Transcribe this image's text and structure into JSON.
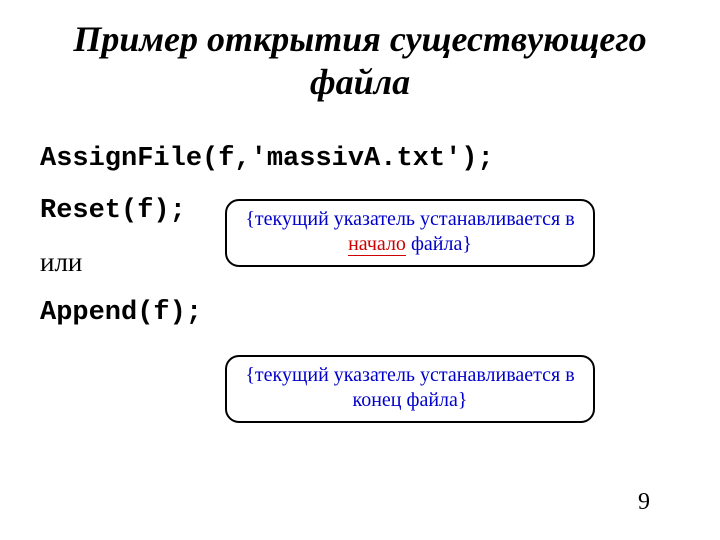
{
  "title": "Пример открытия существующего файла",
  "code": {
    "line1": "AssignFile(f,'massivA.txt');",
    "line2": "Reset(f);",
    "or": "или",
    "line4": "Append(f);"
  },
  "callout1": {
    "prefix": "{текущий указатель устанавливается в ",
    "highlight": "начало",
    "suffix": " файла}"
  },
  "callout2": {
    "text": "{текущий указатель устанавливается в конец файла}"
  },
  "page_number": "9"
}
